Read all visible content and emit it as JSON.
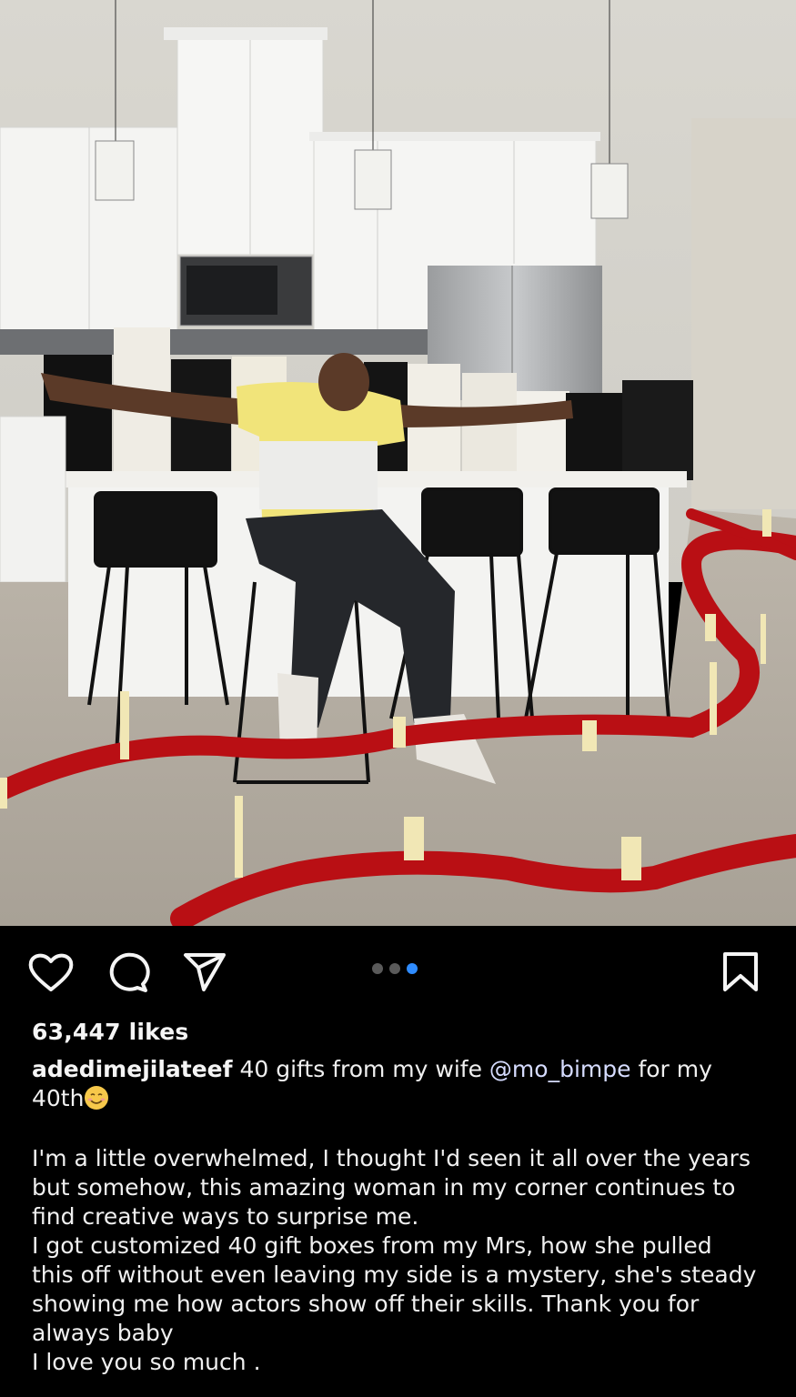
{
  "post": {
    "likes": "63,447 likes",
    "carousel": {
      "count": 3,
      "active_index": 2
    },
    "caption": {
      "username": "adedimejilateef",
      "first_text": " 40 gifts from my wife ",
      "mention": "@mo_bimpe",
      "after_mention": " for my",
      "line2": "40th",
      "emoji": "smiling-face-icon",
      "body_lines": [
        "I'm a little overwhelmed, I thought I'd seen it all over the years",
        "but somehow, this amazing woman in my corner continues to",
        "find creative ways to surprise me.",
        "I got customized 40 gift boxes from my Mrs, how she pulled",
        "this off without even leaving my side is a mystery, she's steady",
        "showing me how actors show off their skills. Thank you for",
        "always baby",
        "I love you so much ."
      ]
    }
  },
  "icons": {
    "like": "heart-icon",
    "comment": "comment-bubble-icon",
    "share": "paper-plane-icon",
    "save": "bookmark-icon"
  },
  "colors": {
    "background": "#000000",
    "text": "#f5f5f5",
    "active_dot": "#2f8cff",
    "inactive_dot": "#5a5a5a"
  }
}
